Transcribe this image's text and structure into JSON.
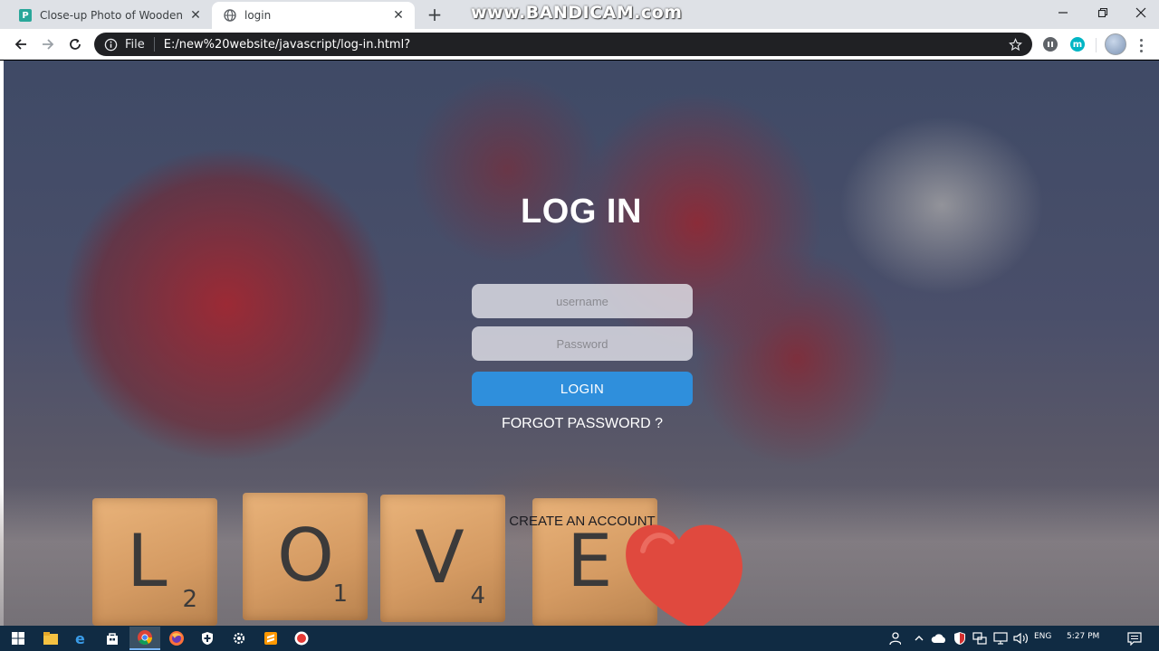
{
  "browser": {
    "tabs": [
      {
        "title": "Close-up Photo of Wooden Scrab",
        "active": false
      },
      {
        "title": "login",
        "active": true
      }
    ],
    "new_tab_glyph": "+",
    "url_chip": "File",
    "url": "E:/new%20website/javascript/log-in.html?",
    "extension_badge": "m",
    "watermark": "www.BANDICAM.com"
  },
  "page": {
    "title": "LOG IN",
    "username_placeholder": "username",
    "password_placeholder": "Password",
    "login_button": "LOGIN",
    "forgot_link": "FORGOT PASSWORD ?",
    "create_link": "CREATE AN ACCOUNT",
    "button_color": "#2f8fdc"
  },
  "tiles": [
    {
      "letter": "L",
      "number": "2"
    },
    {
      "letter": "O",
      "number": "1"
    },
    {
      "letter": "V",
      "number": "4"
    },
    {
      "letter": "E",
      "number": ""
    }
  ],
  "taskbar": {
    "language": "ENG",
    "time": "5:27 PM",
    "icons": [
      "windows-start-icon",
      "file-explorer-icon",
      "edge-icon",
      "store-icon",
      "chrome-icon",
      "firefox-icon",
      "defender-icon",
      "settings-icon",
      "sublime-icon",
      "bandicam-icon"
    ]
  }
}
